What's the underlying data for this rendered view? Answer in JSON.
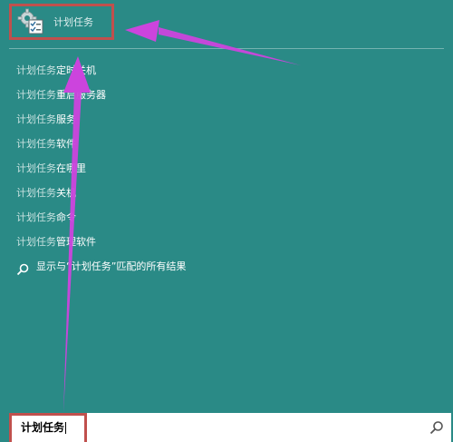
{
  "top_result": {
    "label": "计划任务",
    "icon": "task-scheduler-gear-checklist-icon"
  },
  "suggestions": [
    {
      "query": "计划任务",
      "rest": "定时关机"
    },
    {
      "query": "计划任务",
      "rest": "重启服务器"
    },
    {
      "query": "计划任务",
      "rest": "服务"
    },
    {
      "query": "计划任务",
      "rest": "软件"
    },
    {
      "query": "计划任务",
      "rest": "在哪里"
    },
    {
      "query": "计划任务",
      "rest": "关机"
    },
    {
      "query": "计划任务",
      "rest": "命令"
    },
    {
      "query": "计划任务",
      "rest": "管理软件"
    }
  ],
  "search_all": {
    "text": "显示与“计划任务”匹配的所有结果",
    "icon": "search-icon"
  },
  "search_box": {
    "value": "计划任务",
    "button_icon": "search-icon"
  },
  "colors": {
    "background": "#2a8a86",
    "highlight_box": "#c0504d",
    "arrow": "#cc44dd"
  }
}
